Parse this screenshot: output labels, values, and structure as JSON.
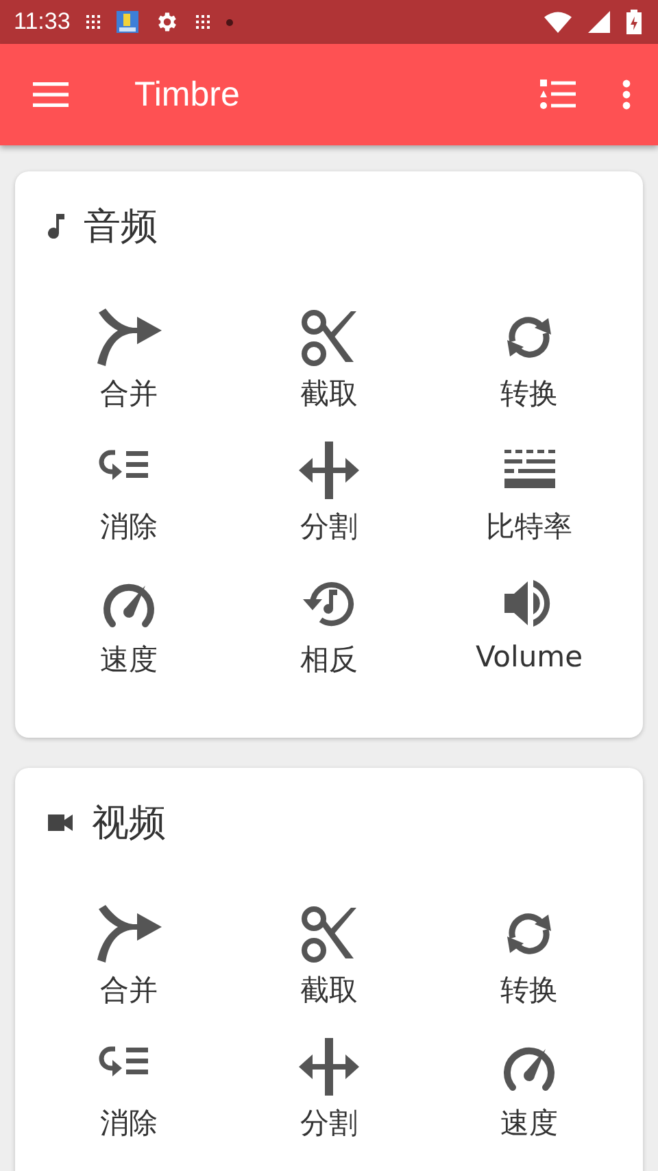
{
  "status_bar": {
    "time": "11:33"
  },
  "toolbar": {
    "title": "Timbre"
  },
  "sections": [
    {
      "kind": "audio",
      "title": "音频",
      "tools": [
        {
          "kind": "merge",
          "label": "合并"
        },
        {
          "kind": "cut",
          "label": "截取"
        },
        {
          "kind": "convert",
          "label": "转换"
        },
        {
          "kind": "remove",
          "label": "消除"
        },
        {
          "kind": "split",
          "label": "分割"
        },
        {
          "kind": "bitrate",
          "label": "比特率"
        },
        {
          "kind": "speed",
          "label": "速度"
        },
        {
          "kind": "reverse",
          "label": "相反"
        },
        {
          "kind": "volume",
          "label": "Volume"
        }
      ]
    },
    {
      "kind": "video",
      "title": "视频",
      "tools": [
        {
          "kind": "merge",
          "label": "合并"
        },
        {
          "kind": "cut",
          "label": "截取"
        },
        {
          "kind": "convert",
          "label": "转换"
        },
        {
          "kind": "remove",
          "label": "消除"
        },
        {
          "kind": "split",
          "label": "分割"
        },
        {
          "kind": "speed",
          "label": "速度"
        }
      ]
    }
  ]
}
